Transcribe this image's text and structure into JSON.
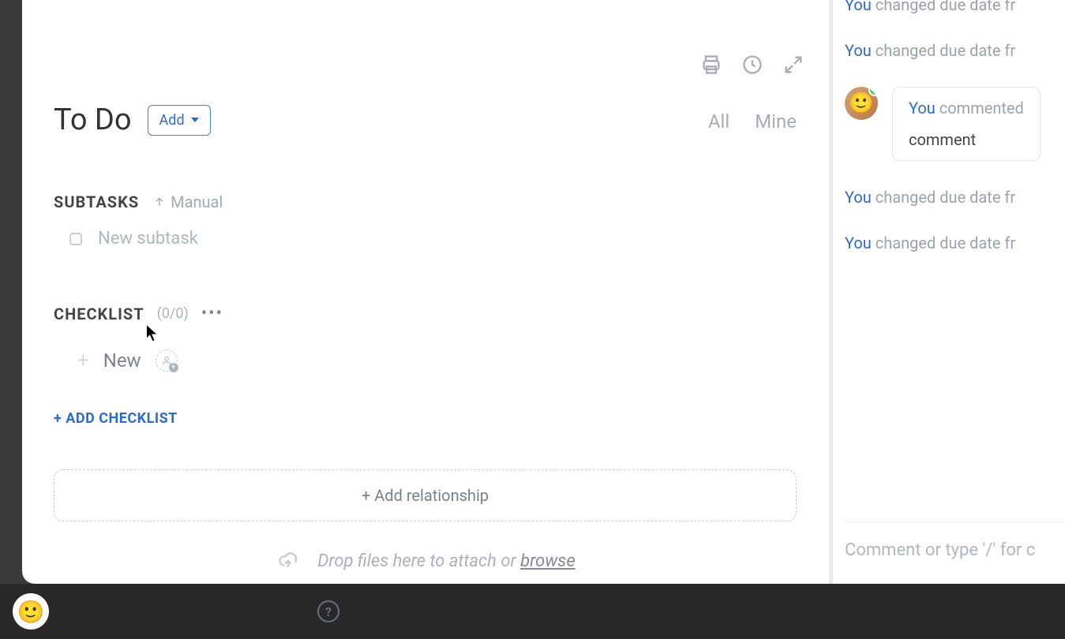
{
  "toolbar": {
    "add_label": "Add"
  },
  "task": {
    "title": "To Do"
  },
  "filters": {
    "all": "All",
    "mine": "Mine"
  },
  "subtasks": {
    "label": "SUBTASKS",
    "sort": "Manual",
    "placeholder": "New subtask"
  },
  "checklist": {
    "label": "CHECKLIST",
    "count": "(0/0)",
    "new_item": "New",
    "add_checklist": "+ ADD CHECKLIST"
  },
  "relationship": {
    "label": "+ Add relationship"
  },
  "dropzone": {
    "text": "Drop files here to attach or ",
    "browse": "browse"
  },
  "activity": {
    "items": [
      {
        "actor": "You",
        "text": " changed due date fr"
      },
      {
        "actor": "You",
        "text": " changed due date fr"
      }
    ],
    "comment": {
      "actor": "You",
      "head": " commented",
      "body": "comment"
    },
    "items_after": [
      {
        "actor": "You",
        "text": " changed due date fr"
      },
      {
        "actor": "You",
        "text": " changed due date fr"
      }
    ],
    "input_placeholder": "Comment or type '/' for c"
  }
}
